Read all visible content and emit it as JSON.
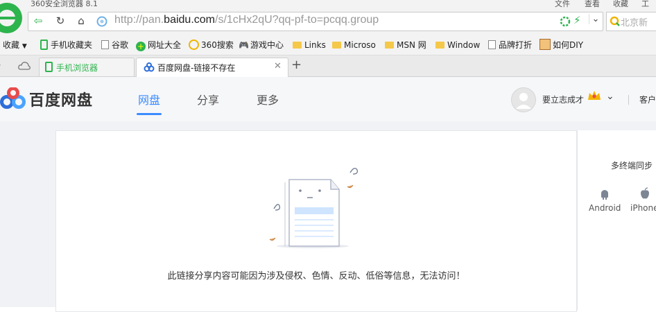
{
  "browser": {
    "title": "360安全浏览器 8.1",
    "menu": [
      "文件",
      "查看",
      "收藏",
      "工具"
    ],
    "url_prefix": "http://pan.",
    "url_domain": "baidu.com",
    "url_path": "/s/1cHx2qU?qq-pf-to=pcqq.group",
    "search_placeholder": "北京新"
  },
  "bookmarks": [
    {
      "label": "收藏",
      "icon": "star-icon"
    },
    {
      "label": "手机收藏夹",
      "icon": "phone-icon"
    },
    {
      "label": "谷歌",
      "icon": "page-icon"
    },
    {
      "label": "网址大全",
      "icon": "plus-icon"
    },
    {
      "label": "360搜索",
      "icon": "search-360-icon"
    },
    {
      "label": "游戏中心",
      "icon": "gamepad-icon"
    },
    {
      "label": "Links",
      "icon": "folder-icon"
    },
    {
      "label": "Microso",
      "icon": "folder-icon"
    },
    {
      "label": "MSN 网",
      "icon": "folder-icon"
    },
    {
      "label": "Window",
      "icon": "folder-icon"
    },
    {
      "label": "品牌打折",
      "icon": "page-icon"
    },
    {
      "label": "如何DIY",
      "icon": "face-icon"
    }
  ],
  "tabs": [
    {
      "label": "手机浏览器",
      "active": false
    },
    {
      "label": "百度网盘-链接不存在",
      "active": true
    }
  ],
  "site": {
    "logo_text": "百度网盘",
    "nav": [
      "网盘",
      "分享",
      "更多"
    ],
    "user_name": "要立志成才",
    "extra": "客户"
  },
  "main": {
    "message": "此链接分享内容可能因为涉及侵权、色情、反动、低俗等信息，无法访问！"
  },
  "sidebar": {
    "sync_title": "多终端同步",
    "platforms": [
      "Android",
      "iPhone"
    ]
  },
  "colors": {
    "accent": "#3b8cff",
    "browser_green": "#2db44d"
  }
}
